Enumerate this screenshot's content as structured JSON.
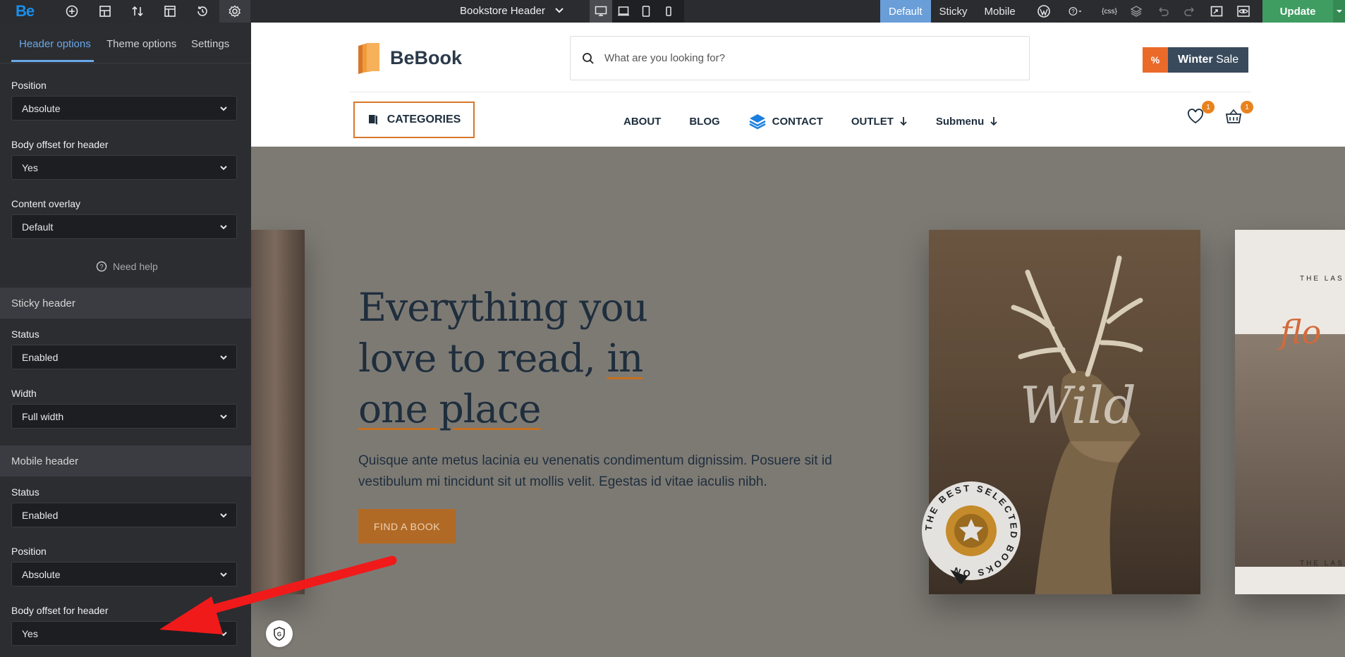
{
  "toolbar": {
    "logo": "Be",
    "header_title": "Bookstore Header",
    "modes": [
      "Default",
      "Sticky",
      "Mobile"
    ],
    "update_label": "Update",
    "css_label": "{css}"
  },
  "sidebar": {
    "tabs": [
      "Header options",
      "Theme options",
      "Settings"
    ],
    "fields": {
      "position_label": "Position",
      "position_value": "Absolute",
      "body_offset_label": "Body offset for header",
      "body_offset_value": "Yes",
      "content_overlay_label": "Content overlay",
      "content_overlay_value": "Default"
    },
    "help_label": "Need help",
    "sticky": {
      "title": "Sticky header",
      "status_label": "Status",
      "status_value": "Enabled",
      "width_label": "Width",
      "width_value": "Full width"
    },
    "mobile": {
      "title": "Mobile header",
      "status_label": "Status",
      "status_value": "Enabled",
      "position_label": "Position",
      "position_value": "Absolute",
      "body_offset_label": "Body offset for header",
      "body_offset_value": "Yes"
    }
  },
  "site": {
    "logo_text": "BeBook",
    "search_placeholder": "What are you looking for?",
    "sale_badge": "%",
    "sale_bold": "Winter",
    "sale_rest": "Sale",
    "categories_label": "CATEGORIES",
    "nav": [
      "ABOUT",
      "BLOG",
      "CONTACT",
      "OUTLET",
      "Submenu"
    ],
    "wishlist_count": "1",
    "cart_count": "1"
  },
  "hero": {
    "title_line1": "Everything you",
    "title_line2a": "love to read,",
    "title_line2b": "in",
    "title_line3": "one place",
    "subtitle": "Quisque ante metus lacinia eu venenatis condimentum dignissim. Posuere sit id vestibulum mi tincidunt sit ut mollis velit. Egestas id vitae iaculis nibh.",
    "cta": "FIND A BOOK",
    "book_word": "Wild",
    "stamp_text": "THE BEST SELECTED BOOKS ON",
    "right_book_top": "THE LAS",
    "right_book_bottom": "THE LAS",
    "right_book_script": "flo"
  },
  "colors": {
    "accent_blue": "#6aa8e8",
    "update_green": "#3f9d62",
    "orange": "#d8772a",
    "annotation_red": "#f01a1a"
  }
}
